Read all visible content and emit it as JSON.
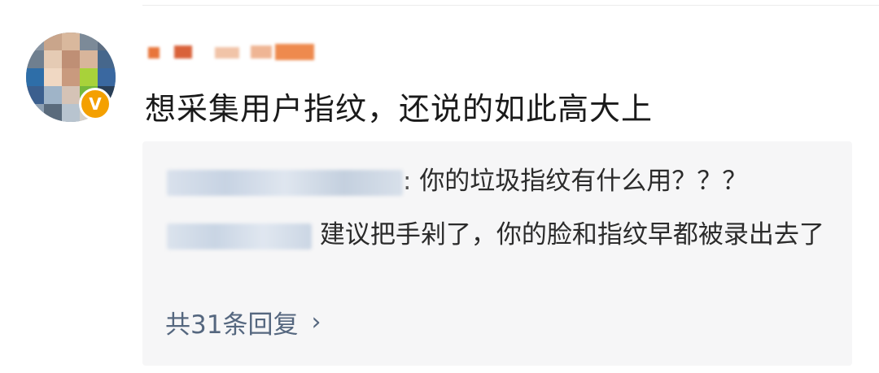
{
  "comment": {
    "text": "想采集用户指纹，还说的如此高大上",
    "avatar_badge": "V"
  },
  "replies": [
    {
      "text": "你的垃圾指纹有什么用？？？"
    },
    {
      "text": "建议把手剁了，你的脸和指纹早都被录出去了"
    }
  ],
  "more_replies_label": "共31条回复",
  "colors": {
    "badge": "#f4a000",
    "link": "#55677f",
    "reply_bg": "#f6f6f7"
  }
}
